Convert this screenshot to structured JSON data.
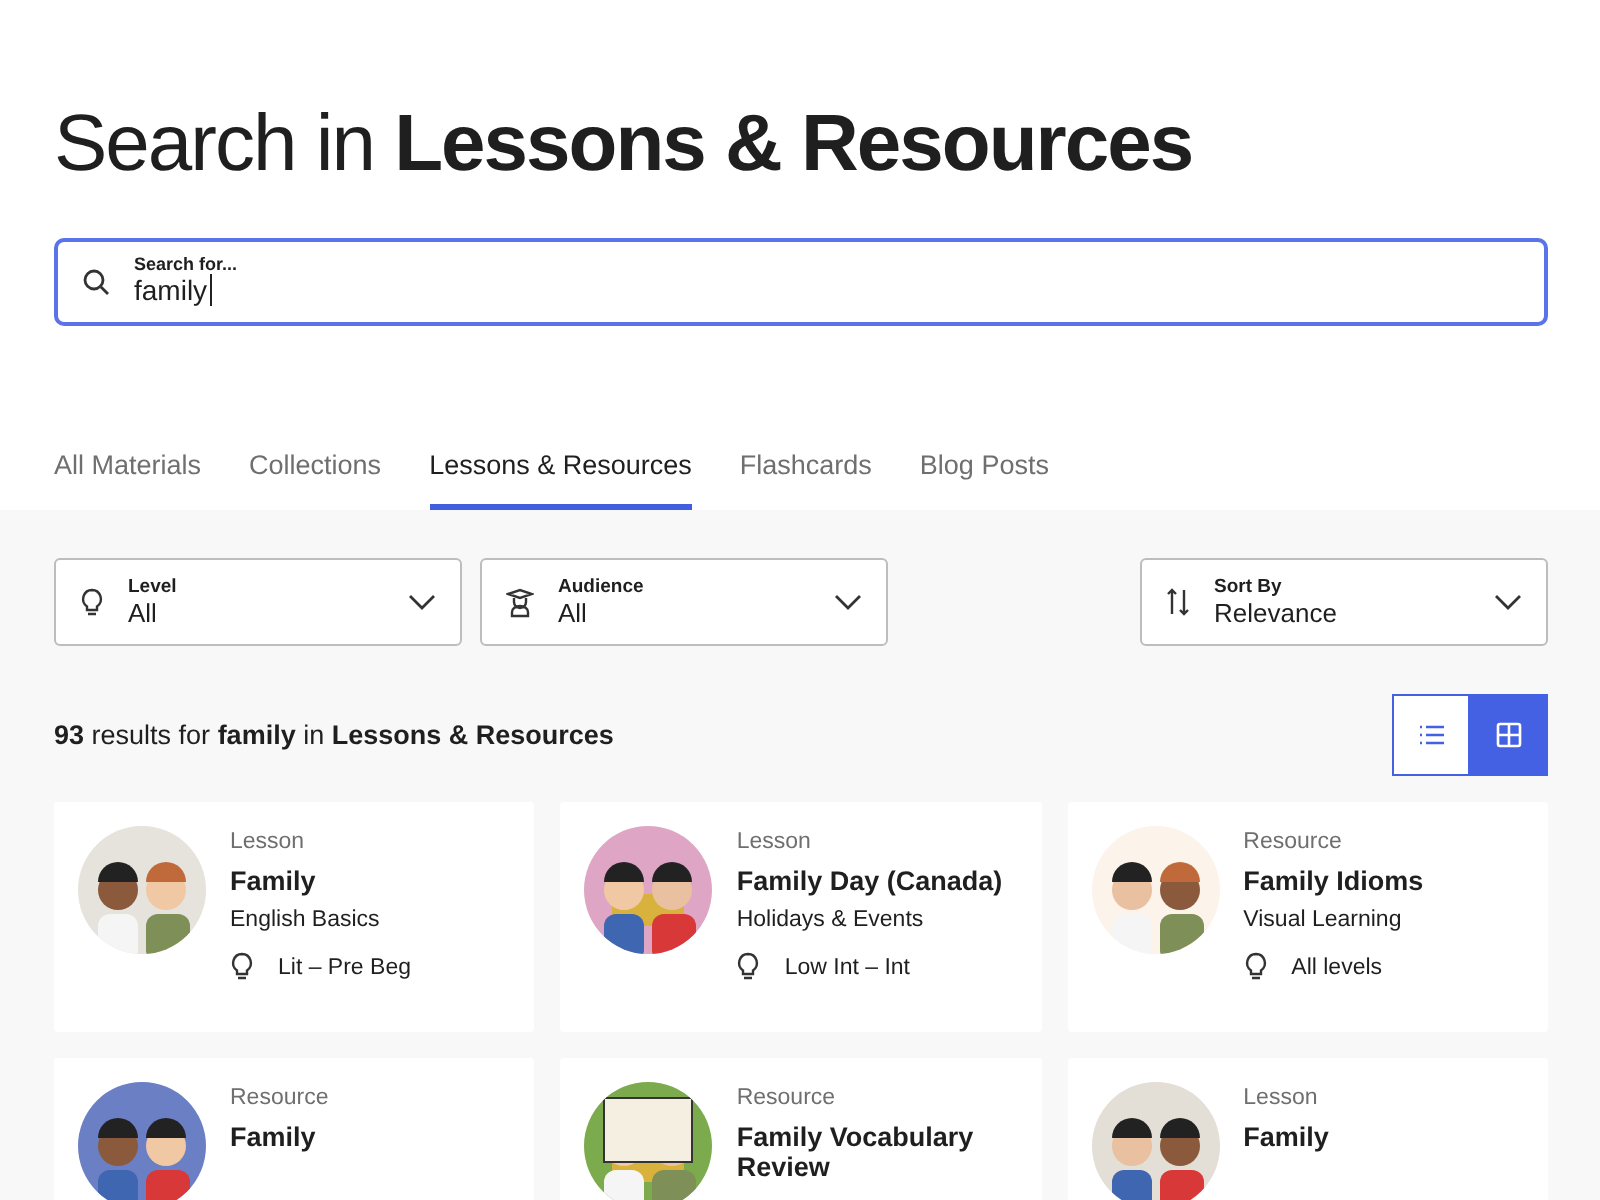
{
  "heading": "Search in **Lessons & Resources**",
  "search": {
    "label": "Search for...",
    "value": "family"
  },
  "tabs": [
    {
      "label": "All Materials",
      "selected": false
    },
    {
      "label": "Collections",
      "selected": false
    },
    {
      "label": "Lessons & Resources",
      "selected": true
    },
    {
      "label": "Flashcards",
      "selected": false
    },
    {
      "label": "Blog Posts",
      "selected": false
    }
  ],
  "filters": [
    {
      "kind": "level",
      "label": "Level",
      "value": "All"
    },
    {
      "kind": "audience",
      "label": "Audience",
      "value": "All"
    }
  ],
  "sort": {
    "label": "Sort By",
    "value": "Relevance"
  },
  "results_text": "**93** results for **family** in **Lessons & Resources**",
  "view_toggle": [
    {
      "kind": "list",
      "selected": false
    },
    {
      "kind": "grid",
      "selected": true
    }
  ],
  "cards": [
    {
      "type": "Lesson",
      "title": "Family",
      "subtitle": "English Basics",
      "level": "Lit – Pre Beg"
    },
    {
      "type": "Lesson",
      "title": "Family Day (Canada)",
      "subtitle": "Holidays & Events",
      "level": "Low Int – Int"
    },
    {
      "type": "Resource",
      "title": "Family Idioms",
      "subtitle": "Visual Learning",
      "level": "All levels"
    },
    {
      "type": "Resource",
      "title": "Family"
    },
    {
      "type": "Resource",
      "title": "Family Vocabulary Review"
    },
    {
      "type": "Lesson",
      "title": "Family"
    }
  ]
}
